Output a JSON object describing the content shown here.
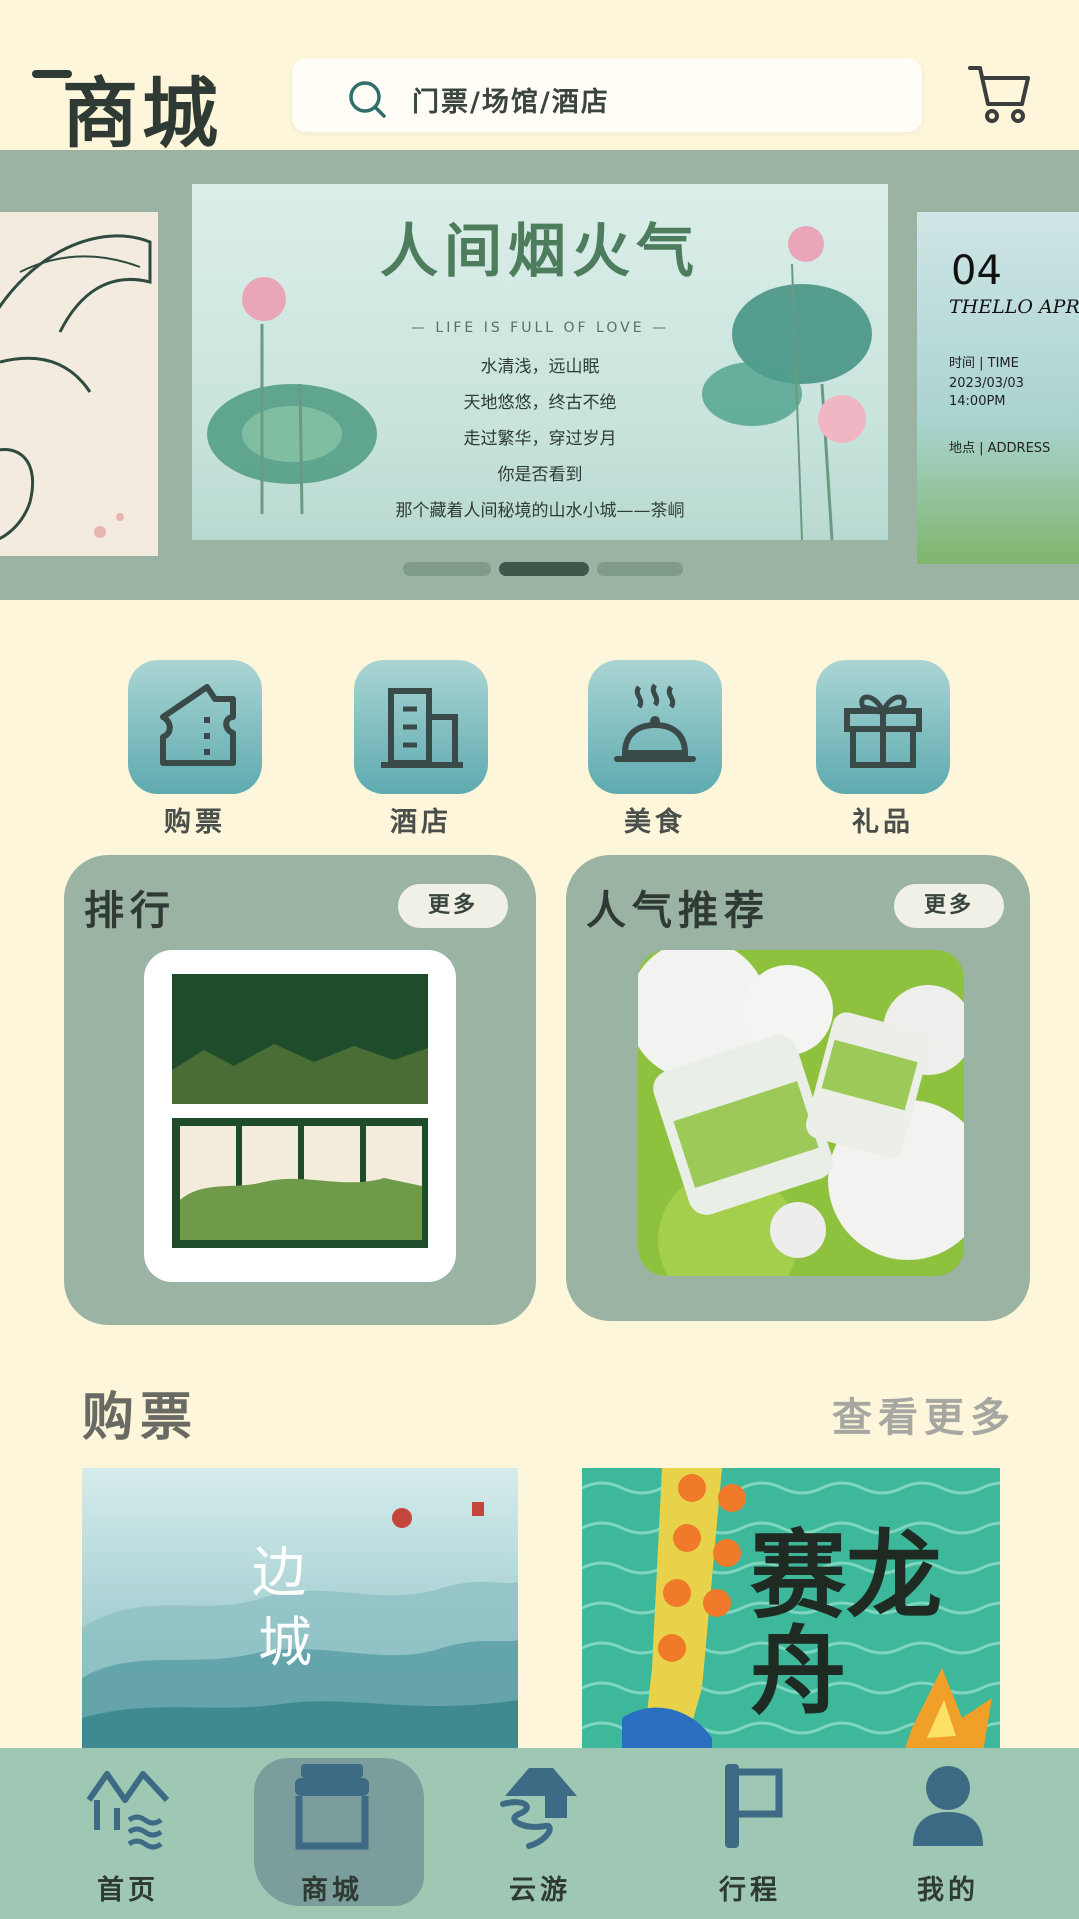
{
  "header": {
    "title": "商城",
    "search_placeholder": "门票/场馆/酒店",
    "icons": [
      "search-icon",
      "cart-icon"
    ]
  },
  "banner": {
    "main": {
      "title": "人间烟火气",
      "subtitle": "— LIFE IS FULL OF LOVE —",
      "lines": [
        "水清浅，远山眠",
        "天地悠悠，终古不绝",
        "走过繁华，穿过岁月",
        "你是否看到",
        "那个藏着人间秘境的山水小城——茶峒"
      ]
    },
    "right": {
      "number": "04",
      "hello": "THELLO APRIL",
      "time_label": "时间 | TIME",
      "date": "2023/03/03",
      "time": "14:00PM",
      "place_label": "地点 | ADDRESS"
    },
    "dots": 3,
    "active_dot": 1
  },
  "categories": [
    {
      "label": "购票",
      "icon": "ticket-icon"
    },
    {
      "label": "酒店",
      "icon": "hotel-icon"
    },
    {
      "label": "美食",
      "icon": "food-icon"
    },
    {
      "label": "礼品",
      "icon": "gift-icon"
    }
  ],
  "cards": {
    "ranking": {
      "title": "排行",
      "more": "更多"
    },
    "popular": {
      "title": "人气推荐",
      "more": "更多"
    }
  },
  "section": {
    "title": "购票",
    "more": "查看更多",
    "poster_left": {
      "title_1": "边",
      "title_2": "城"
    },
    "poster_right": {
      "title": "赛龙舟"
    }
  },
  "nav": [
    {
      "label": "首页",
      "icon": "home-icon"
    },
    {
      "label": "商城",
      "icon": "shop-icon",
      "active": true
    },
    {
      "label": "云游",
      "icon": "cloud-tour-icon"
    },
    {
      "label": "行程",
      "icon": "flag-icon"
    },
    {
      "label": "我的",
      "icon": "profile-icon"
    }
  ],
  "colors": {
    "background": "#fdf6da",
    "panel": "#9ab3a3",
    "nav": "#9ec8b3",
    "icon_tile": "#5eaab0"
  }
}
